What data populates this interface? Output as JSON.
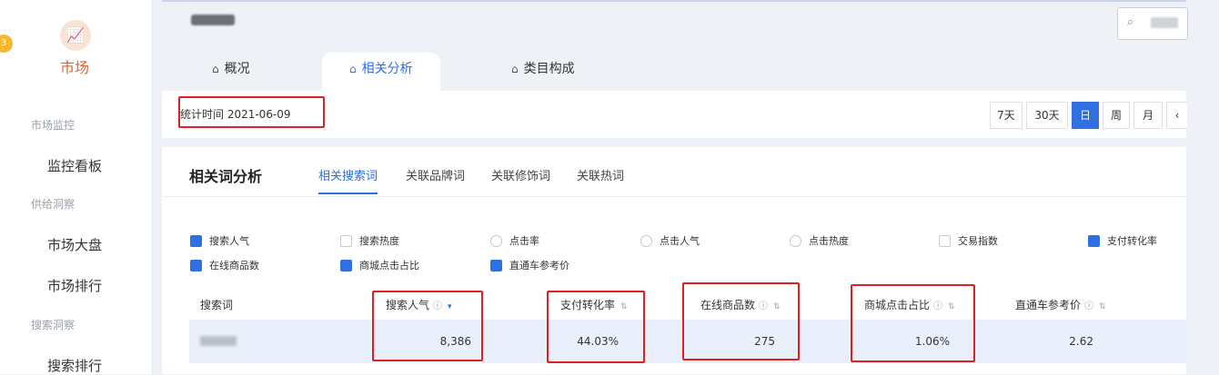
{
  "sidebar": {
    "badge": "3",
    "market_icon": "market-chart-icon",
    "market_label": "市场",
    "groups": [
      {
        "label": "市场监控",
        "items": [
          "监控看板"
        ]
      },
      {
        "label": "供给洞察",
        "items": [
          "市场大盘",
          "市场排行"
        ]
      },
      {
        "label": "搜索洞察",
        "items": [
          "搜索排行"
        ]
      }
    ]
  },
  "header": {
    "tabs": [
      {
        "label": "概况"
      },
      {
        "label": "相关分析"
      },
      {
        "label": "类目构成"
      }
    ],
    "active_tab": "相关分析"
  },
  "datebar": {
    "stat_time": "统计时间 2021-06-09",
    "ranges": [
      "7天",
      "30天",
      "日",
      "周",
      "月"
    ],
    "active_range": "日",
    "prev_icon": "chevron-left-icon"
  },
  "analysis": {
    "title": "相关词分析",
    "sub_tabs": [
      "相关搜索词",
      "关联品牌词",
      "关联修饰词",
      "关联热词"
    ],
    "active_sub_tab": "相关搜索词",
    "metrics_row1": [
      {
        "label": "搜索人气",
        "checked": true
      },
      {
        "label": "搜索热度",
        "checked": false
      },
      {
        "label": "点击率",
        "checked": false
      },
      {
        "label": "点击人气",
        "checked": false
      },
      {
        "label": "点击热度",
        "checked": false
      },
      {
        "label": "交易指数",
        "checked": false
      },
      {
        "label": "支付转化率",
        "checked": true
      }
    ],
    "metrics_row2": [
      {
        "label": "在线商品数",
        "checked": true
      },
      {
        "label": "商城点击占比",
        "checked": true
      },
      {
        "label": "直通车参考价",
        "checked": true
      }
    ],
    "columns": [
      "搜索词",
      "搜索人气",
      "支付转化率",
      "在线商品数",
      "商城点击占比",
      "直通车参考价"
    ],
    "row": {
      "keyword": "",
      "search_popularity": "8,386",
      "payment_conversion": "44.03%",
      "online_products": "275",
      "mall_click_share": "1.06%",
      "through_train_price": "2.62"
    }
  },
  "colors": {
    "accent": "#2f6fe0",
    "highlight_box": "#e02020",
    "brand": "#e0632e"
  }
}
